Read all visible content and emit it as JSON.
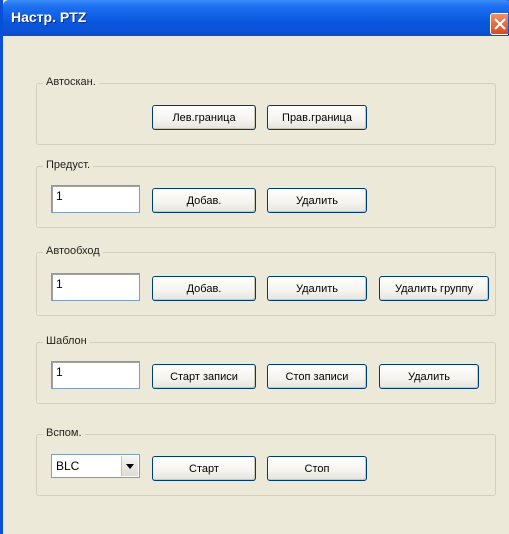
{
  "window": {
    "title": "Настр. PTZ"
  },
  "autoscan": {
    "legend": "Автоскан.",
    "left_bound_label": "Лев.граница",
    "right_bound_label": "Прав.граница"
  },
  "preset": {
    "legend": "Предуст.",
    "value": "1",
    "add_label": "Добав.",
    "delete_label": "Удалить"
  },
  "tour": {
    "legend": "Автообход",
    "value": "1",
    "add_label": "Добав.",
    "delete_label": "Удалить",
    "delete_group_label": "Удалить группу"
  },
  "pattern": {
    "legend": "Шаблон",
    "value": "1",
    "start_record_label": "Старт записи",
    "stop_record_label": "Стоп записи",
    "delete_label": "Удалить"
  },
  "aux": {
    "legend": "Вспом.",
    "selected": "BLC",
    "start_label": "Старт",
    "stop_label": "Стоп"
  }
}
